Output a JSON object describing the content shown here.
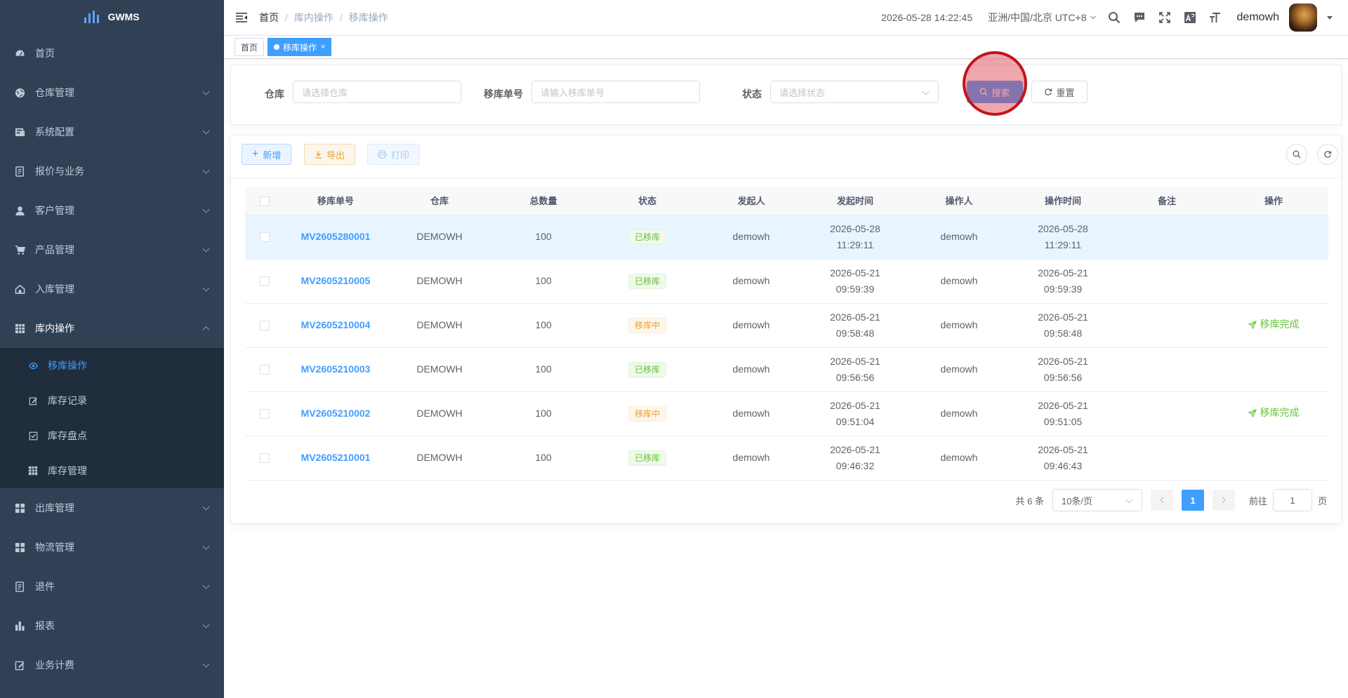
{
  "app": {
    "logo": "GWMS"
  },
  "sidebar": {
    "items": [
      {
        "label": "首页",
        "icon": "dashboard-icon",
        "chevron": false
      },
      {
        "label": "仓库管理",
        "icon": "globe-icon",
        "chevron": true
      },
      {
        "label": "系统配置",
        "icon": "server-icon",
        "chevron": true
      },
      {
        "label": "报价与业务",
        "icon": "form-icon",
        "chevron": true
      },
      {
        "label": "客户管理",
        "icon": "user-icon",
        "chevron": true
      },
      {
        "label": "产品管理",
        "icon": "cart-icon",
        "chevron": true
      },
      {
        "label": "入库管理",
        "icon": "home-icon",
        "chevron": true
      },
      {
        "label": "库内操作",
        "icon": "table-icon",
        "chevron": true,
        "expanded": true
      }
    ],
    "sub_items": [
      {
        "label": "移库操作",
        "icon": "eye-icon",
        "active": true
      },
      {
        "label": "库存记录",
        "icon": "edit-icon"
      },
      {
        "label": "库存盘点",
        "icon": "checkbox-icon"
      },
      {
        "label": "库存管理",
        "icon": "grid-icon"
      }
    ],
    "items_after": [
      {
        "label": "出库管理",
        "icon": "apps-icon"
      },
      {
        "label": "物流管理",
        "icon": "apps-icon"
      },
      {
        "label": "退件",
        "icon": "form-icon"
      },
      {
        "label": "报表",
        "icon": "chart-icon"
      },
      {
        "label": "业务计费",
        "icon": "edit-icon"
      }
    ]
  },
  "navbar": {
    "breadcrumb": [
      "首页",
      "库内操作",
      "移库操作"
    ],
    "datetime": "2026-05-28 14:22:45",
    "timezone": "亚洲/中国/北京 UTC+8",
    "user": "demowh"
  },
  "tags": {
    "home": "首页",
    "active": "移库操作"
  },
  "search": {
    "warehouse_label": "仓库",
    "warehouse_placeholder": "请选择仓库",
    "move_no_label": "移库单号",
    "move_no_placeholder": "请输入移库单号",
    "status_label": "状态",
    "status_placeholder": "请选择状态",
    "search_button": "搜索",
    "reset_button": "重置"
  },
  "toolbar": {
    "add": "新增",
    "export": "导出",
    "print": "打印"
  },
  "table": {
    "columns": [
      "移库单号",
      "仓库",
      "总数量",
      "状态",
      "发起人",
      "发起时间",
      "操作人",
      "操作时间",
      "备注",
      "操作"
    ],
    "rows": [
      {
        "no": "MV2605280001",
        "warehouse": "DEMOWH",
        "qty": "100",
        "status": "已移库",
        "status_type": "ok",
        "initiator": "demowh",
        "init_date": "2026-05-28",
        "init_time": "11:29:11",
        "operator": "demowh",
        "op_date": "2026-05-28",
        "op_time": "11:29:11",
        "remark": "",
        "action": ""
      },
      {
        "no": "MV2605210005",
        "warehouse": "DEMOWH",
        "qty": "100",
        "status": "已移库",
        "status_type": "ok",
        "initiator": "demowh",
        "init_date": "2026-05-21",
        "init_time": "09:59:39",
        "operator": "demowh",
        "op_date": "2026-05-21",
        "op_time": "09:59:39",
        "remark": "",
        "action": ""
      },
      {
        "no": "MV2605210004",
        "warehouse": "DEMOWH",
        "qty": "100",
        "status": "移库中",
        "status_type": "doing",
        "initiator": "demowh",
        "init_date": "2026-05-21",
        "init_time": "09:58:48",
        "operator": "demowh",
        "op_date": "2026-05-21",
        "op_time": "09:58:48",
        "remark": "",
        "action": "移库完成"
      },
      {
        "no": "MV2605210003",
        "warehouse": "DEMOWH",
        "qty": "100",
        "status": "已移库",
        "status_type": "ok",
        "initiator": "demowh",
        "init_date": "2026-05-21",
        "init_time": "09:56:56",
        "operator": "demowh",
        "op_date": "2026-05-21",
        "op_time": "09:56:56",
        "remark": "",
        "action": ""
      },
      {
        "no": "MV2605210002",
        "warehouse": "DEMOWH",
        "qty": "100",
        "status": "移库中",
        "status_type": "doing",
        "initiator": "demowh",
        "init_date": "2026-05-21",
        "init_time": "09:51:04",
        "operator": "demowh",
        "op_date": "2026-05-21",
        "op_time": "09:51:05",
        "remark": "",
        "action": "移库完成"
      },
      {
        "no": "MV2605210001",
        "warehouse": "DEMOWH",
        "qty": "100",
        "status": "已移库",
        "status_type": "ok",
        "initiator": "demowh",
        "init_date": "2026-05-21",
        "init_time": "09:46:32",
        "operator": "demowh",
        "op_date": "2026-05-21",
        "op_time": "09:46:43",
        "remark": "",
        "action": ""
      }
    ]
  },
  "pagination": {
    "total_text": "共 6 条",
    "page_size": "10条/页",
    "current_page": "1",
    "goto_label": "前往",
    "goto_value": "1",
    "page_suffix": "页"
  },
  "colors": {
    "sidebar_bg": "#304156",
    "submenu_bg": "#1f2d3d",
    "primary": "#409eff",
    "success": "#67c23a",
    "warning": "#e6a23c"
  }
}
